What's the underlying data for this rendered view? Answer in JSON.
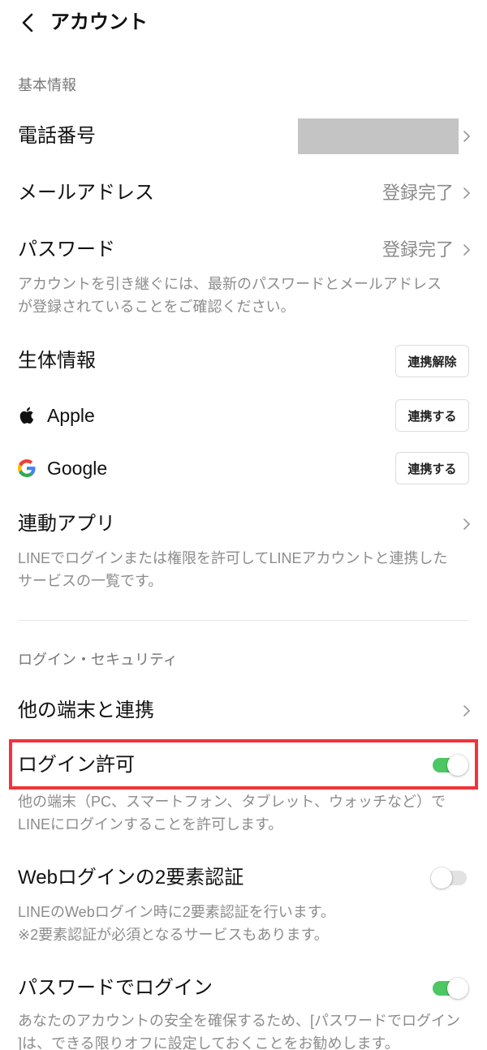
{
  "header": {
    "title": "アカウント",
    "back_icon": "chevron-left-icon"
  },
  "basic_info": {
    "section_label": "基本情報",
    "phone": {
      "label": "電話番号"
    },
    "email": {
      "label": "メールアドレス",
      "status": "登録完了"
    },
    "password": {
      "label": "パスワード",
      "status": "登録完了",
      "description": [
        "アカウントを引き継ぐには、最新のパスワードとメールアドレス",
        "が登録されていることをご確認ください。"
      ]
    },
    "biometric": {
      "label": "生体情報",
      "button": "連携解除"
    },
    "apple": {
      "icon": "apple-icon",
      "label": "Apple",
      "button": "連携する"
    },
    "google": {
      "icon": "google-icon",
      "label": "Google",
      "button": "連携する"
    },
    "linked_apps": {
      "label": "連動アプリ",
      "description": [
        "LINEでログインまたは権限を許可してLINEアカウントと連携した",
        "サービスの一覧です。"
      ]
    }
  },
  "login_security": {
    "section_label": "ログイン・セキュリティ",
    "other_devices": {
      "label": "他の端末と連携"
    },
    "login_permission": {
      "label": "ログイン許可",
      "enabled": true,
      "description": [
        "他の端末（PC、スマートフォン、タブレット、ウォッチなど）で",
        "LINEにログインすることを許可します。"
      ]
    },
    "web_2fa": {
      "label": "Webログインの2要素認証",
      "enabled": false,
      "description": [
        "LINEのWebログイン時に2要素認証を行います。",
        "※2要素認証が必須となるサービスもあります。"
      ]
    },
    "password_login": {
      "label": "パスワードでログイン",
      "enabled": true,
      "description": [
        "あなたのアカウントの安全を確保するため、[パスワードでログイン",
        "]は、できる限りオフに設定しておくことをお勧めします。"
      ]
    }
  },
  "colors": {
    "toggle_on": "#4cc764",
    "toggle_off": "#e2e2e2",
    "highlight": "#f2333a",
    "redacted": "#c4c4c4"
  }
}
